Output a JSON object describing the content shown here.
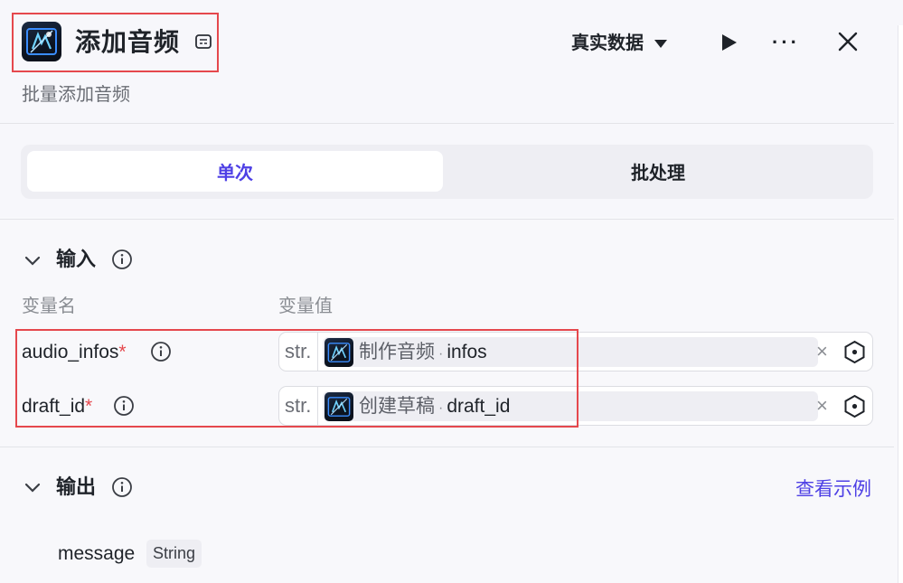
{
  "header": {
    "title": "添加音频",
    "subtitle": "批量添加音频",
    "data_mode": "真实数据",
    "more": "···"
  },
  "tabs": [
    {
      "label": "单次",
      "active": true
    },
    {
      "label": "批处理",
      "active": false
    }
  ],
  "input": {
    "title": "输入",
    "col_name": "变量名",
    "col_value": "变量值",
    "rows": [
      {
        "name": "audio_infos",
        "required": "*",
        "type": "str.",
        "node": "制作音频",
        "sep": "·",
        "field": "infos",
        "clear": "×"
      },
      {
        "name": "draft_id",
        "required": "*",
        "type": "str.",
        "node": "创建草稿",
        "sep": "·",
        "field": "draft_id",
        "clear": "×"
      }
    ]
  },
  "output": {
    "title": "输出",
    "view_example": "查看示例",
    "items": [
      {
        "name": "message",
        "type": "String"
      }
    ]
  },
  "colors": {
    "accent": "#4e40e5",
    "highlight": "#e5484d"
  }
}
